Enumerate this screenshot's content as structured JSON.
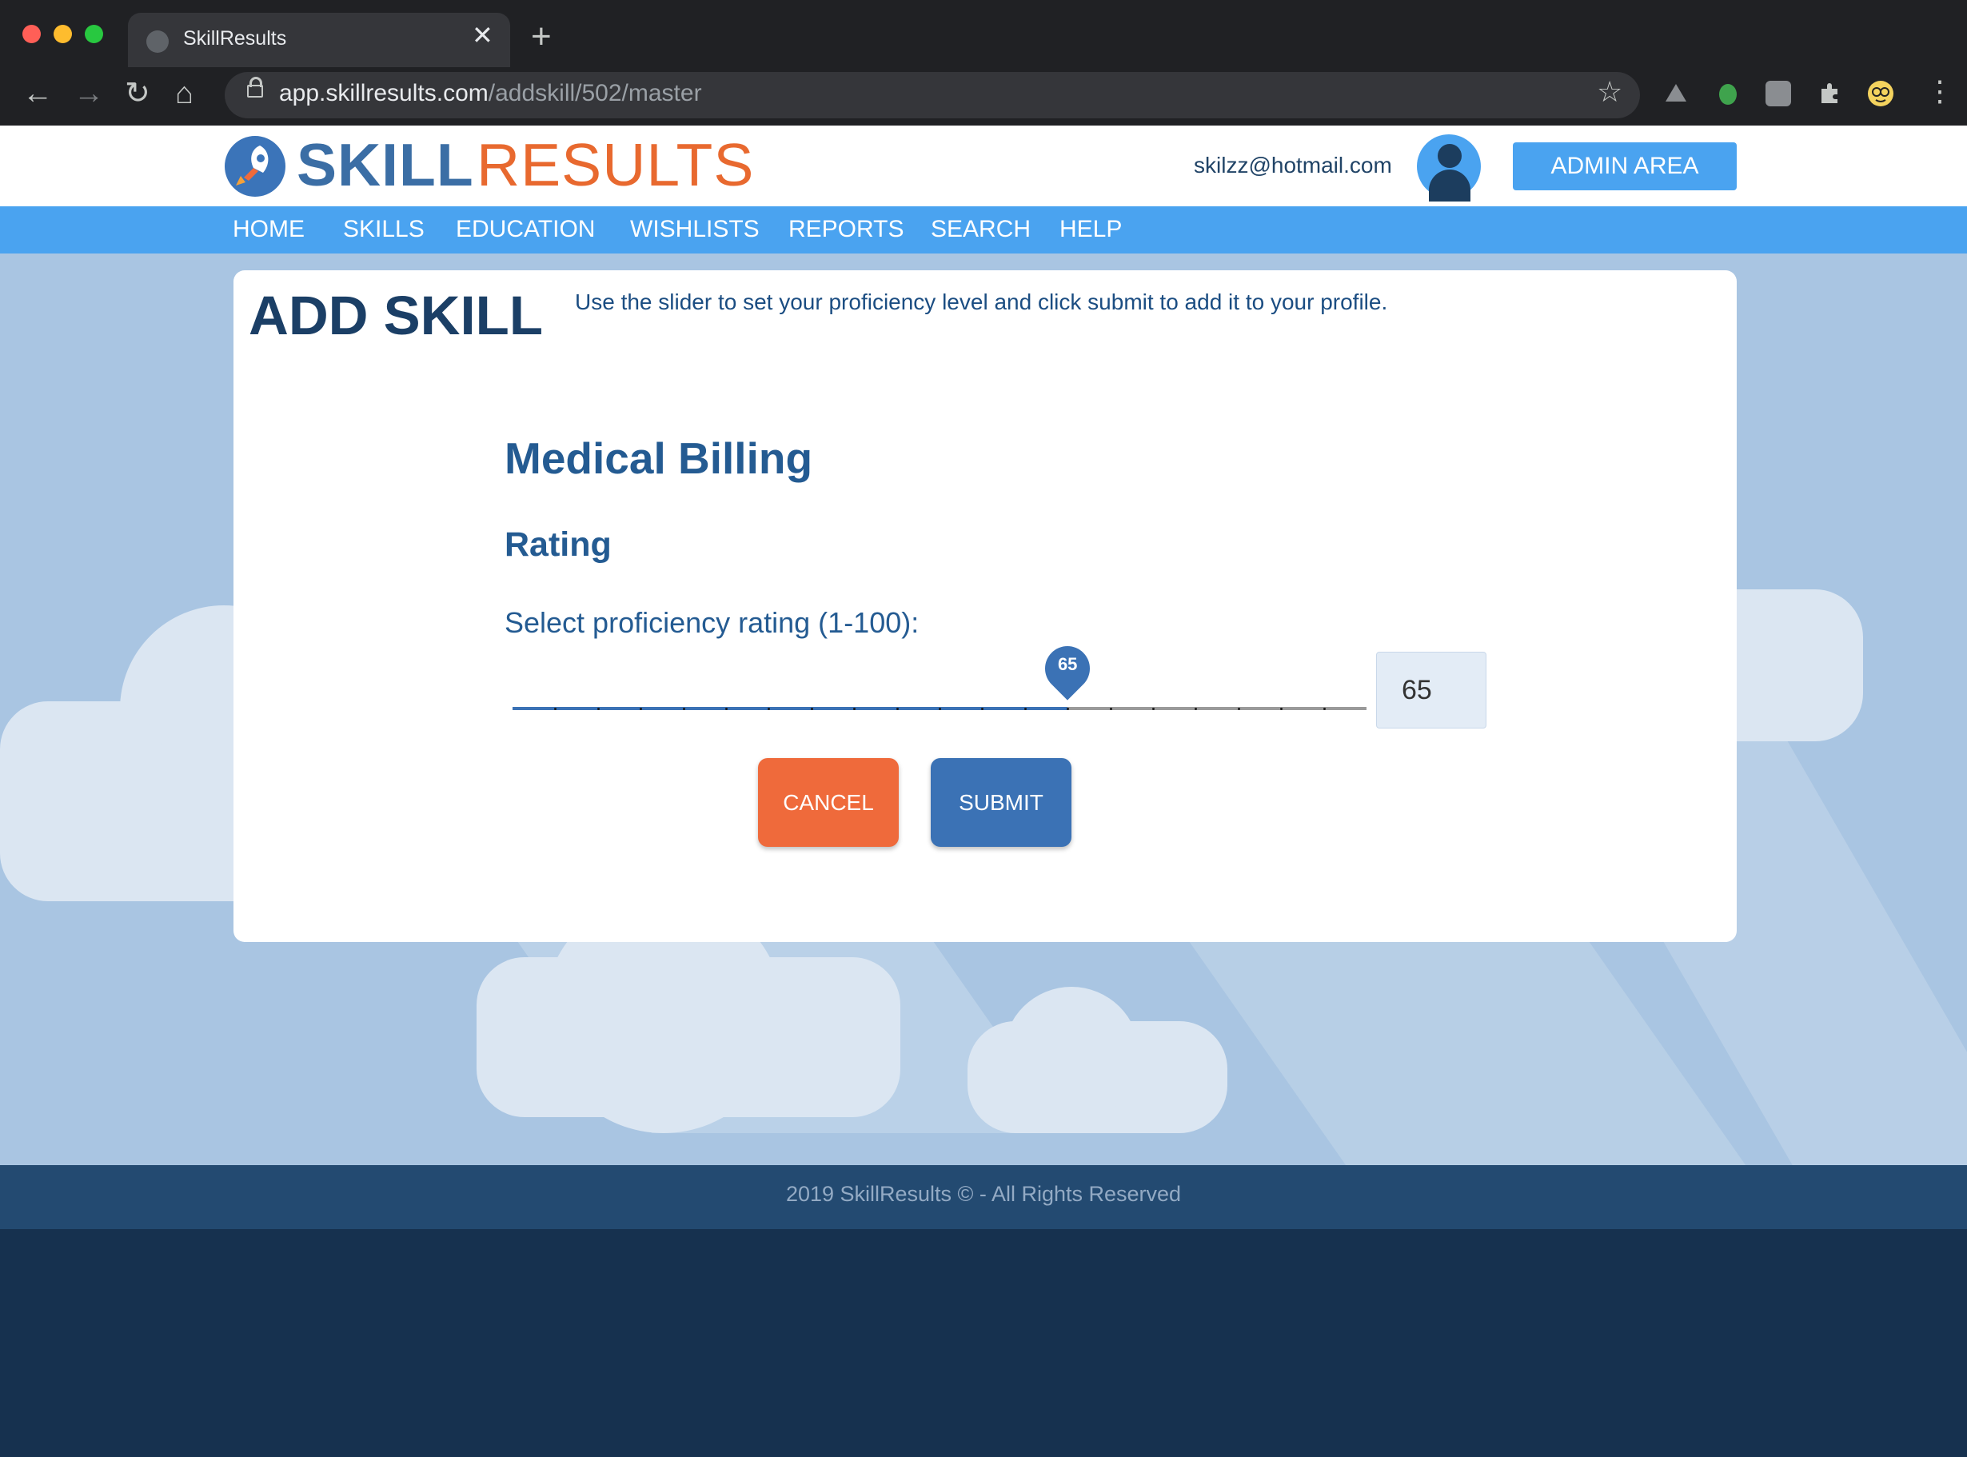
{
  "browser": {
    "tab_title": "SkillResults",
    "tab_close": "✕",
    "new_tab": "+",
    "url_domain": "app.skillresults.com",
    "url_path": "/addskill/502/master",
    "back": "←",
    "forward": "→",
    "reload": "↻",
    "home": "⌂",
    "bookmark": "☆",
    "menu": "⋮",
    "traffic_lights": [
      "#ff5f57",
      "#febc2e",
      "#28c840"
    ]
  },
  "header": {
    "logo_part1": "SKILL",
    "logo_part2": "RESULTS",
    "user_email": "skilzz@hotmail.com",
    "admin_button": "ADMIN AREA"
  },
  "nav": {
    "items": [
      "HOME",
      "SKILLS",
      "EDUCATION",
      "WISHLISTS",
      "REPORTS",
      "SEARCH",
      "HELP"
    ]
  },
  "page": {
    "title": "ADD SKILL",
    "description": "Use the slider to set your proficiency level and click submit to add it to your profile.",
    "skill_name": "Medical Billing",
    "rating_heading": "Rating",
    "rating_prompt": "Select proficiency rating (1-100):",
    "rating_value": "65",
    "rating_fraction": 0.65,
    "cancel_button": "CANCEL",
    "submit_button": "SUBMIT"
  },
  "footer": {
    "text": "2019 SkillResults © - All Rights Reserved"
  },
  "colors": {
    "brand_blue": "#4aa3f0",
    "brand_dark": "#1b3f66",
    "accent_orange": "#ef6a3b",
    "submit_blue": "#3b72b5"
  }
}
